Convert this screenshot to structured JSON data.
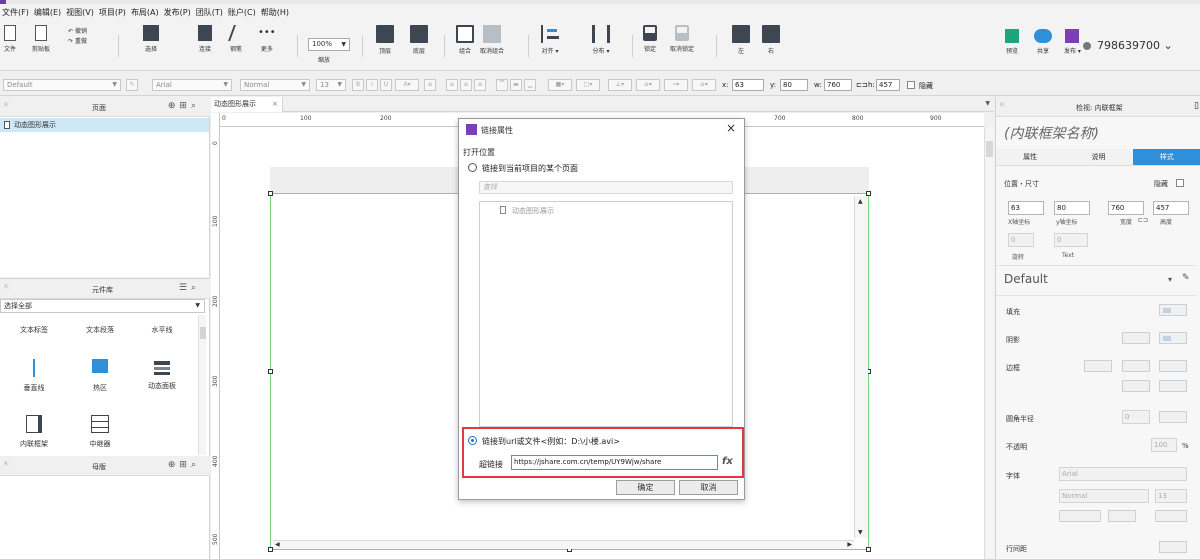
{
  "menubar": [
    "文件(F)",
    "编辑(E)",
    "视图(V)",
    "项目(P)",
    "布局(A)",
    "发布(P)",
    "团队(T)",
    "账户(C)",
    "帮助(H)"
  ],
  "toolbar": {
    "file_label": "文件",
    "clipboard_label": "剪贴板",
    "undo_label": "撤销",
    "redo_label": "重做",
    "select_label": "选择",
    "connect_label": "连接",
    "pen_label": "钢笔",
    "more_label": "更多",
    "zoom_value": "100%",
    "zoom_label": "缩放",
    "top_label": "顶层",
    "bottom_label": "底层",
    "group_label": "组合",
    "ungroup_label": "取消组合",
    "align_label": "对齐",
    "distribute_label": "分布",
    "lock_label": "锁定",
    "unlock_label": "取消锁定",
    "left_label": "左",
    "right_label": "右",
    "preview_label": "预览",
    "share_label": "共享",
    "publish_label": "发布",
    "user_id": "798639700"
  },
  "format": {
    "style": "Default",
    "font": "Arial",
    "weight": "Normal",
    "size": "13",
    "bold": "B",
    "italic": "I",
    "underline": "U",
    "x_label": "x:",
    "x_value": "63",
    "y_label": "y:",
    "y_value": "80",
    "w_label": "w:",
    "w_value": "760",
    "h_label": "h:",
    "h_value": "457",
    "hidden_label": "隐藏"
  },
  "pages": {
    "title": "页面",
    "items": [
      "动态图形展示"
    ]
  },
  "library": {
    "title": "元件库",
    "selected": "选择全部",
    "widgets": [
      "文本标签",
      "文本段落",
      "水平线",
      "垂直线",
      "热区",
      "动态面板",
      "内联框架",
      "中继器"
    ]
  },
  "masters": {
    "title": "母版"
  },
  "canvas": {
    "tab_label": "动态图形展示",
    "ruler_h": [
      "0",
      "100",
      "200",
      "700",
      "800",
      "900"
    ],
    "ruler_v": [
      "0",
      "100",
      "200",
      "300",
      "400",
      "500"
    ]
  },
  "dialog": {
    "title": "链接属性",
    "section": "打开位置",
    "option_page": "链接到当前项目的某个页面",
    "search_placeholder": "查找",
    "tree_node": "动态图形展示",
    "option_url": "链接到url或文件<例如：D:\\小楼.avi>",
    "url_label": "超链接",
    "url_value": "https://jshare.com.cn/temp/UY9Wjw/share",
    "fx": "fx",
    "ok": "确定",
    "cancel": "取消",
    "selected_option": "url"
  },
  "inspector": {
    "title": "检视: 内联框架",
    "name_placeholder": "(内联框架名称)",
    "tabs": [
      "属性",
      "说明",
      "样式"
    ],
    "active_tab": "样式",
    "position_size": "位置・尺寸",
    "hidden": "隐藏",
    "x": "63",
    "y": "80",
    "w": "760",
    "h": "457",
    "x_cap": "X轴坐标",
    "y_cap": "y轴坐标",
    "w_cap": "宽度",
    "h_cap": "高度",
    "rot": "0",
    "rot_cap": "旋转",
    "text_rot": "0",
    "text_cap": "Text",
    "style_name": "Default",
    "fill": "填充",
    "shadow": "阴影",
    "border": "边框",
    "radius": "圆角半径",
    "radius_value": "0",
    "opacity": "不透明",
    "opacity_value": "100",
    "opacity_unit": "%",
    "font_label": "字体",
    "font_value": "Arial",
    "weight_value": "Normal",
    "size_value": "13",
    "line_spacing": "行间距"
  },
  "colors": {
    "accent_blue": "#2f8fd8",
    "highlight_red": "#e03a3a",
    "selection_green": "#7bd37b",
    "page_selected": "#cde8f6"
  }
}
